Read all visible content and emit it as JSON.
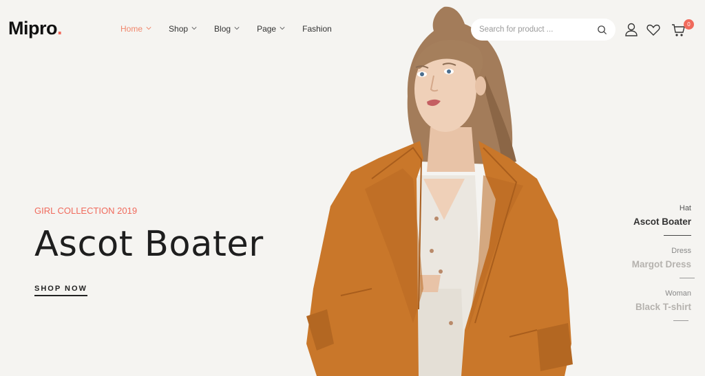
{
  "header": {
    "logo_text": "Mipro",
    "logo_dot": ".",
    "nav": [
      {
        "label": "Home",
        "has_dropdown": true,
        "active": true
      },
      {
        "label": "Shop",
        "has_dropdown": true,
        "active": false
      },
      {
        "label": "Blog",
        "has_dropdown": true,
        "active": false
      },
      {
        "label": "Page",
        "has_dropdown": true,
        "active": false
      },
      {
        "label": "Fashion",
        "has_dropdown": false,
        "active": false
      }
    ],
    "search": {
      "placeholder": "Search for product ...",
      "value": "",
      "icon": "search-icon"
    },
    "icons": {
      "account": "user-icon",
      "wishlist": "heart-icon",
      "cart": "cart-icon"
    },
    "cart_count": "0"
  },
  "hero": {
    "subtitle": "GIRL COLLECTION 2019",
    "title": "Ascot Boater",
    "cta_label": "SHOP NOW",
    "image_alt": "Model wearing an orange trench coat over a white button-up top"
  },
  "slides": [
    {
      "category": "Hat",
      "name": "Ascot Boater",
      "active": true
    },
    {
      "category": "Dress",
      "name": "Margot Dress",
      "active": false
    },
    {
      "category": "Woman",
      "name": "Black T-shirt",
      "active": false
    }
  ],
  "colors": {
    "background": "#f5f4f1",
    "accent": "#f06a5c",
    "nav_active": "#f0866b",
    "text_dark": "#1e1e1e",
    "coat": "#c9772a"
  }
}
